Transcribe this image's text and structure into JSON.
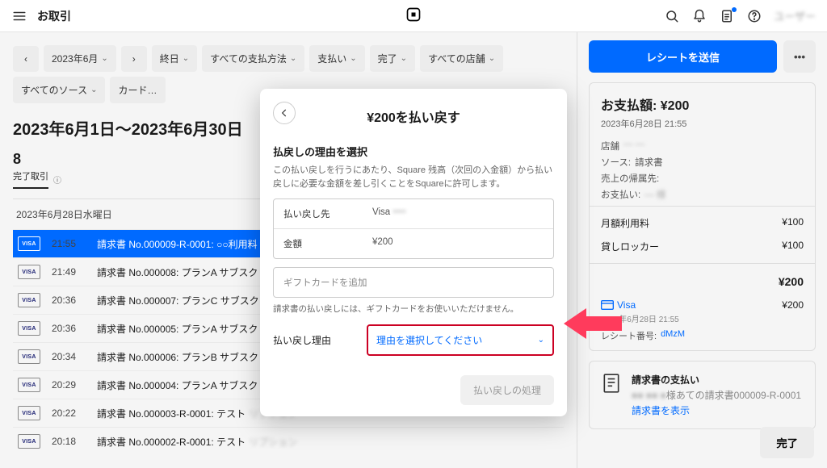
{
  "header": {
    "title": "お取引",
    "username": "ユーザー"
  },
  "filters": {
    "date": "2023年6月",
    "f1": "終日",
    "f2": "すべての支払方法",
    "f3": "支払い",
    "f4": "完了",
    "f5": "すべての店舗",
    "f6": "すべてのソース",
    "f7": "カード…"
  },
  "range_title": "2023年6月1日〜2023年6月30日",
  "summary": {
    "count": "8",
    "tab": "完了取引",
    "tab_icon": "ⓘ"
  },
  "day_label": "2023年6月28日水曜日",
  "rows": [
    {
      "time": "21:55",
      "desc": "請求書 No.000009-R-0001: ○○利用料",
      "selected": true
    },
    {
      "time": "21:49",
      "desc": "請求書 No.000008: プランA サブスク"
    },
    {
      "time": "20:36",
      "desc": "請求書 No.000007: プランC サブスク"
    },
    {
      "time": "20:36",
      "desc": "請求書 No.000005: プランA サブスク"
    },
    {
      "time": "20:34",
      "desc": "請求書 No.000006: プランB サブスク"
    },
    {
      "time": "20:29",
      "desc": "請求書 No.000004: プランA サブスク"
    },
    {
      "time": "20:22",
      "desc": "請求書 No.000003-R-0001: テスト"
    },
    {
      "time": "20:18",
      "desc": "請求書 No.000002-R-0001: テスト"
    }
  ],
  "card_label": "VISA",
  "side": {
    "primary_btn": "レシートを送信",
    "more_btn": "•••",
    "pay_title": "お支払額: ¥200",
    "pay_dt": "2023年6月28日 21:55",
    "meta": {
      "store_label": "店舗",
      "store_val": "— —",
      "source_label": "ソース:",
      "source_val": "請求書",
      "billto_label": "売上の帰属先:",
      "billto_val": "",
      "payee_label": "お支払い:",
      "payee_val": "— 様"
    },
    "items": [
      {
        "name": "月額利用料",
        "price": "¥100"
      },
      {
        "name": "貸しロッカー",
        "price": "¥100"
      }
    ],
    "total_label": "",
    "total_val": "¥200",
    "pay_row_label": "Visa",
    "pay_row_val": "¥200",
    "pay_row_dt": "2023年6月28日 21:55",
    "receipt_no_label": "レシート番号:",
    "receipt_no_val": "dMzM",
    "invoice": {
      "title": "請求書の支払い",
      "sub": "様あての請求書000009-R-0001",
      "link": "請求書を表示"
    },
    "done_btn": "完了"
  },
  "modal": {
    "title": "¥200を払い戻す",
    "section_title": "払戻しの理由を選択",
    "desc": "この払い戻しを行うにあたり、Square 残高（次回の入金額）から払い戻しに必要な金額を差し引くことをSquareに許可します。",
    "dest_label": "払い戻し先",
    "dest_val": "Visa",
    "amount_label": "金額",
    "amount_val": "¥200",
    "gift_placeholder": "ギフトカードを追加",
    "note": "請求書の払い戻しには、ギフトカードをお使いいただけません。",
    "reason_label": "払い戻し理由",
    "reason_placeholder": "理由を選択してください",
    "submit": "払い戻しの処理"
  }
}
